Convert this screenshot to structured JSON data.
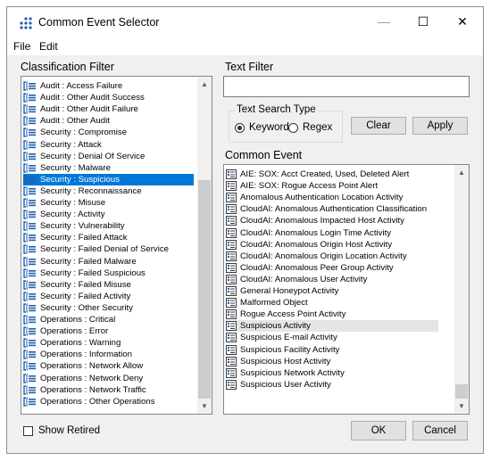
{
  "window": {
    "title": "Common Event Selector",
    "minimize_glyph": "—",
    "maximize_glyph": "☐",
    "close_glyph": "✕"
  },
  "menu": {
    "file": "File",
    "edit": "Edit"
  },
  "classification": {
    "label": "Classification Filter",
    "items": [
      "Audit : Access Failure",
      "Audit : Other Audit Success",
      "Audit : Other Audit Failure",
      "Audit : Other Audit",
      "Security : Compromise",
      "Security : Attack",
      "Security : Denial Of Service",
      "Security : Malware",
      "Security : Suspicious",
      "Security : Reconnaissance",
      "Security : Misuse",
      "Security : Activity",
      "Security : Vulnerability",
      "Security : Failed Attack",
      "Security : Failed Denial of Service",
      "Security : Failed Malware",
      "Security : Failed Suspicious",
      "Security : Failed Misuse",
      "Security : Failed Activity",
      "Security : Other Security",
      "Operations : Critical",
      "Operations : Error",
      "Operations : Warning",
      "Operations : Information",
      "Operations : Network Allow",
      "Operations : Network Deny",
      "Operations : Network Traffic",
      "Operations : Other Operations"
    ],
    "selected_item": "Security : Suspicious"
  },
  "text_filter": {
    "label": "Text Filter",
    "value": "",
    "search_type_label": "Text Search Type",
    "keyword_label": "Keyword",
    "regex_label": "Regex",
    "selected_mode": "Keyword",
    "clear_label": "Clear",
    "apply_label": "Apply"
  },
  "common_event": {
    "label": "Common Event",
    "items": [
      "AIE: SOX: Acct Created, Used, Deleted Alert",
      "AIE: SOX: Rogue Access Point Alert",
      "Anomalous Authentication Location Activity",
      "CloudAI: Anomalous Authentication Classification",
      "CloudAI: Anomalous Impacted Host Activity",
      "CloudAI: Anomalous Login Time Activity",
      "CloudAI: Anomalous Origin Host Activity",
      "CloudAI: Anomalous Origin Location Activity",
      "CloudAI: Anomalous Peer Group Activity",
      "CloudAI: Anomalous User Activity",
      "General Honeypot Activity",
      "Malformed Object",
      "Rogue Access Point Activity",
      "Suspicious Activity",
      "Suspicious E-mail Activity",
      "Suspicious Facility Activity",
      "Suspicious Host Activity",
      "Suspicious Network Activity",
      "Suspicious User Activity"
    ],
    "highlighted_item": "Suspicious Activity"
  },
  "footer": {
    "show_retired_label": "Show Retired",
    "ok_label": "OK",
    "cancel_label": "Cancel"
  },
  "colors": {
    "selection": "#0078d7",
    "hover": "#e5e5e5",
    "icon_blue": "#1f5fb0"
  },
  "icons": {
    "app": "dots-grid-icon",
    "classification_item": "classification-tree-icon",
    "event_item": "event-document-icon"
  }
}
